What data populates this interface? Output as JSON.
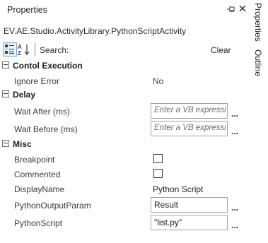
{
  "panel": {
    "title": "Properties",
    "type_name": "EV.AE.Studio.ActivityLibrary.PythonScriptActivity"
  },
  "toolbar": {
    "categorized_icon": "categorized-view-icon",
    "alphabetical_icon": "sort-alphabetical-icon",
    "search_label": "Search:",
    "clear_label": "Clear"
  },
  "categories": {
    "control_execution": "Contol Execution",
    "delay": "Delay",
    "misc": "Misc"
  },
  "properties": {
    "ignore_error": {
      "name": "Ignore Error",
      "value": "No"
    },
    "wait_after": {
      "name": "Wait After (ms)",
      "placeholder": "Enter a VB expressi"
    },
    "wait_before": {
      "name": "Wait Before (ms)",
      "placeholder": "Enter a VB expressi"
    },
    "breakpoint": {
      "name": "Breakpoint",
      "checked": false
    },
    "commented": {
      "name": "Commented",
      "checked": false
    },
    "display_name": {
      "name": "DisplayName",
      "value": "Python Script"
    },
    "python_output_param": {
      "name": "PythonOutputParam",
      "value": "Result"
    },
    "python_script": {
      "name": "PythonScript",
      "value": "\"list.py\""
    }
  },
  "ellipsis": "...",
  "side_tabs": {
    "properties": "Properties",
    "outline": "Outline"
  }
}
